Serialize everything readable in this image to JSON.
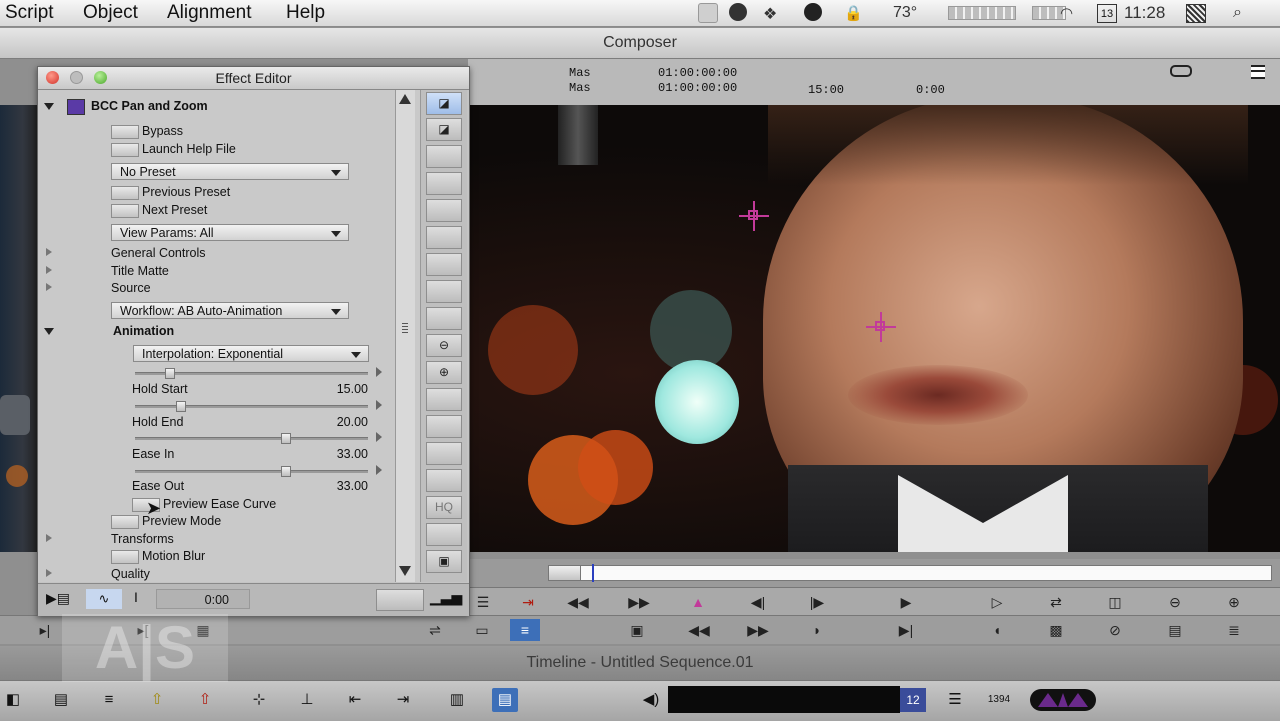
{
  "menubar": {
    "items": [
      "Script",
      "Object",
      "Alignment",
      "Help"
    ],
    "temperature": "73°",
    "clock": "11:28",
    "calendar_day": "13"
  },
  "composer": {
    "title": "Composer",
    "tc_label_1": "Mas",
    "tc_label_2": "Mas",
    "tc_value_1": "01:00:00:00",
    "tc_value_2": "01:00:00:00",
    "duration": "15:00",
    "position": "0:00"
  },
  "effect_editor": {
    "title": "Effect Editor",
    "effect_name": "BCC Pan and Zoom",
    "bypass": "Bypass",
    "launch_help": "Launch Help File",
    "preset_dropdown": "No Preset",
    "previous_preset": "Previous Preset",
    "next_preset": "Next Preset",
    "view_params": "View Params: All",
    "general_controls": "General Controls",
    "title_matte": "Title Matte",
    "source": "Source",
    "workflow": "Workflow: AB Auto-Animation",
    "animation": "Animation",
    "interpolation": "Interpolation: Exponential",
    "hold_start_label": "Hold Start",
    "hold_start_value": "15.00",
    "hold_end_label": "Hold End",
    "hold_end_value": "20.00",
    "ease_in_label": "Ease In",
    "ease_in_value": "33.00",
    "ease_out_label": "Ease Out",
    "ease_out_value": "33.00",
    "preview_ease_curve": "Preview Ease Curve",
    "preview_mode": "Preview Mode",
    "transforms": "Transforms",
    "motion_blur": "Motion Blur",
    "quality": "Quality",
    "bottom_time": "0:00",
    "hq_label": "HQ"
  },
  "timeline": {
    "title": "Timeline - Untitled Sequence.01"
  },
  "colors": {
    "crosshair": "#c23a9a",
    "avid_logo": "#6a2a8c"
  }
}
